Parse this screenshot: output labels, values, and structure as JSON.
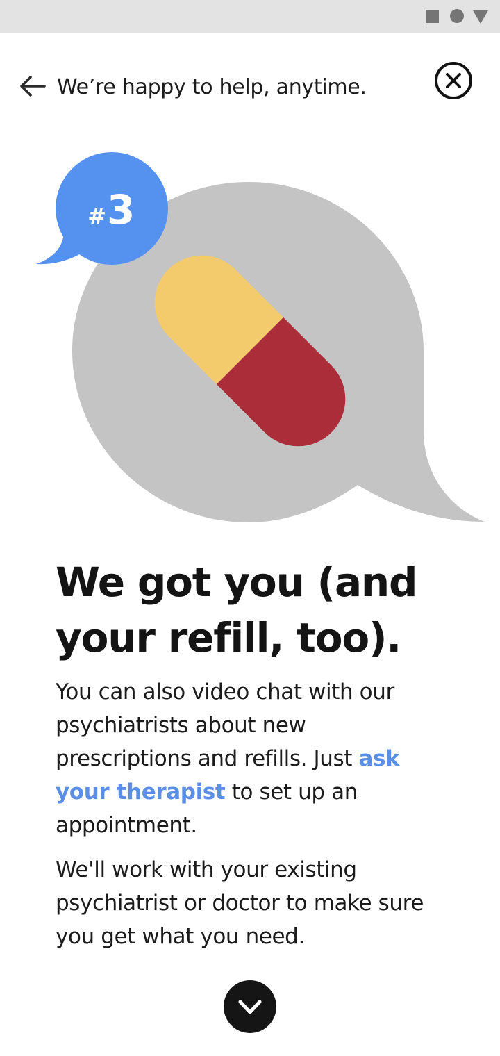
{
  "status_bar": {
    "icons": [
      "square-icon",
      "circle-icon",
      "triangle-icon"
    ]
  },
  "header": {
    "title": "We’re happy to help, anytime.",
    "back_icon": "arrow-left-icon",
    "close_icon": "close-circle-icon"
  },
  "illustration": {
    "badge_text": "#3",
    "badge_hash": "#",
    "badge_number": "3",
    "badge_color": "#5592f0",
    "bubble_color": "#c4c4c4",
    "pill_colors": [
      "#f3ca6c",
      "#ac2d3a"
    ]
  },
  "content": {
    "headline_line1": "We got you (and",
    "headline_line2": "your refill, too).",
    "para1_before_link": "You can also video chat with our psychiatrists about new prescriptions and refills. Just ",
    "para1_link": "ask your therapist",
    "para1_after_link": " to set up an appointment.",
    "para2": "We'll work with your existing psychiatrist or doctor to make sure you get what you need.",
    "link_color": "#5b8fe6"
  },
  "footer": {
    "next_icon": "chevron-down-icon"
  }
}
